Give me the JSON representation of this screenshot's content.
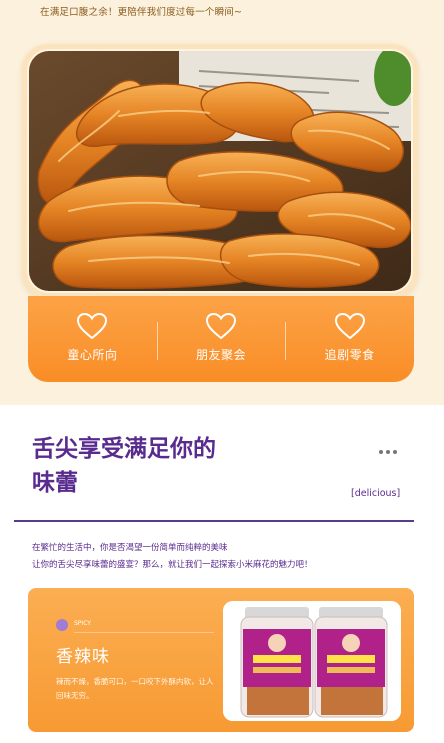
{
  "header": {
    "caption": "在满足口腹之余！更陪伴我们度过每一个瞬间~"
  },
  "features": [
    {
      "label": "童心所向",
      "icon": "heart-icon"
    },
    {
      "label": "朋友聚会",
      "icon": "heart-icon"
    },
    {
      "label": "追剧零食",
      "icon": "heart-icon"
    }
  ],
  "section": {
    "title_line1": "舌尖享受满足你的",
    "title_line2": "味蕾",
    "tag": "[delicious]",
    "desc_line1": "在繁忙的生活中，你是否渴望一份简单而纯粹的美味",
    "desc_line2": "让你的舌尖尽享味蕾的盛宴？那么，就让我们一起探索小米麻花的魅力吧！"
  },
  "product": {
    "small_label": "SPICY",
    "flavor_name": "香辣味",
    "flavor_desc": "辣而不燥，香脆可口，一口咬下外酥内软，让人回味无穷。"
  },
  "colors": {
    "accent_purple": "#5a2b8f",
    "accent_orange": "#f98d26",
    "top_background": "#fcf1dc"
  }
}
